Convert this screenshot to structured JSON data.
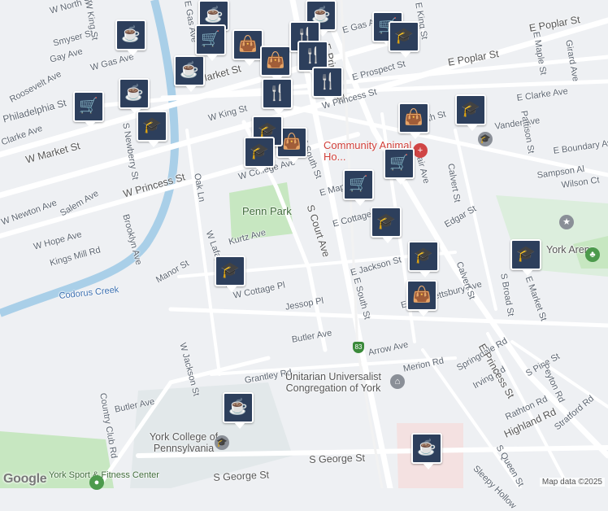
{
  "map": {
    "parks": [
      "Penn Park"
    ],
    "water": [
      "Codorus Creek"
    ],
    "places": [
      {
        "name": "Community Animal Ho...",
        "kind": "poi-red"
      },
      {
        "name": "York Arena",
        "kind": "venue"
      },
      {
        "name": "Unitarian Universalist Congregation of York",
        "kind": "church"
      },
      {
        "name": "York College of Pennsylvania",
        "kind": "school"
      },
      {
        "name": "York Sport & Fitness Center",
        "kind": "sport"
      }
    ],
    "streets": [
      "W North St",
      "Smyser St",
      "Gay Ave",
      "W Gas Ave",
      "Roosevelt Ave",
      "Clarke Ave",
      "Philadelphia St",
      "W Market St",
      "W King St",
      "W Princess St",
      "W College Ave",
      "S Newberry St",
      "Oak Ln",
      "Salem Ave",
      "W Newton Ave",
      "W Hope Ave",
      "Brooklyn Ave",
      "Kings Mill Rd",
      "Manor St",
      "W Lafayette St",
      "Kurtz Ave",
      "W Cottage Pl",
      "Jessop Pl",
      "W Jackson St",
      "Butler Ave",
      "Grantley Rd",
      "Country Club Rd",
      "S George St",
      "S Court Ave",
      "E South St",
      "E Maple St",
      "E Cottage Pl",
      "E Jackson St",
      "E Springettsbury Ave",
      "Arrow Ave",
      "Merion Rd",
      "Springdale Rd",
      "Irving Rd",
      "S Pine St",
      "Peyton Rd",
      "Rathton Rd",
      "Highland Rd",
      "Stratford Rd",
      "Sleepy Hollow",
      "S Queen St",
      "E Princess St",
      "E Poplar St",
      "E Prospect St",
      "E Clarke Ave",
      "E South St",
      "Vander Ave",
      "Pattison St",
      "Girard Ave",
      "E Maple St",
      "E Boundary Ave",
      "Sampson Al",
      "Wilson Ct",
      "Fair Ave",
      "Calvert St",
      "Edgar St",
      "S Broad St",
      "E Market St",
      "E King St",
      "E Gas Ave",
      "S Pine St",
      "E Boundary Ave",
      "Elm St",
      "S Queen St",
      "Court Ave"
    ],
    "route_shield": "83",
    "colors": {
      "water": "#a9cfe8",
      "park": "#c7e7c1",
      "road": "#ffffff",
      "poi": "#2d3f5c"
    }
  },
  "markers": [
    {
      "type": "cafe",
      "icon": "coffee-icon"
    },
    {
      "type": "cafe",
      "icon": "coffee-icon"
    },
    {
      "type": "cafe",
      "icon": "coffee-icon"
    },
    {
      "type": "cafe",
      "icon": "coffee-icon"
    },
    {
      "type": "cafe",
      "icon": "coffee-icon"
    },
    {
      "type": "shop",
      "icon": "shopping-bag-icon"
    },
    {
      "type": "shop",
      "icon": "shopping-bag-icon"
    },
    {
      "type": "shop",
      "icon": "shopping-bag-icon"
    },
    {
      "type": "grocery",
      "icon": "cart-icon"
    },
    {
      "type": "grocery",
      "icon": "cart-icon"
    },
    {
      "type": "grocery",
      "icon": "cart-icon"
    },
    {
      "type": "restaurant",
      "icon": "fork-knife-icon"
    },
    {
      "type": "restaurant",
      "icon": "fork-knife-icon"
    },
    {
      "type": "restaurant",
      "icon": "fork-knife-icon"
    },
    {
      "type": "school",
      "icon": "graduation-cap-icon"
    },
    {
      "type": "school",
      "icon": "graduation-cap-icon"
    },
    {
      "type": "school",
      "icon": "graduation-cap-icon"
    },
    {
      "type": "school",
      "icon": "graduation-cap-icon"
    },
    {
      "type": "school",
      "icon": "graduation-cap-icon"
    },
    {
      "type": "school",
      "icon": "graduation-cap-icon"
    }
  ],
  "footer": {
    "logo": "Google",
    "attribution": "Map data ©2025"
  }
}
